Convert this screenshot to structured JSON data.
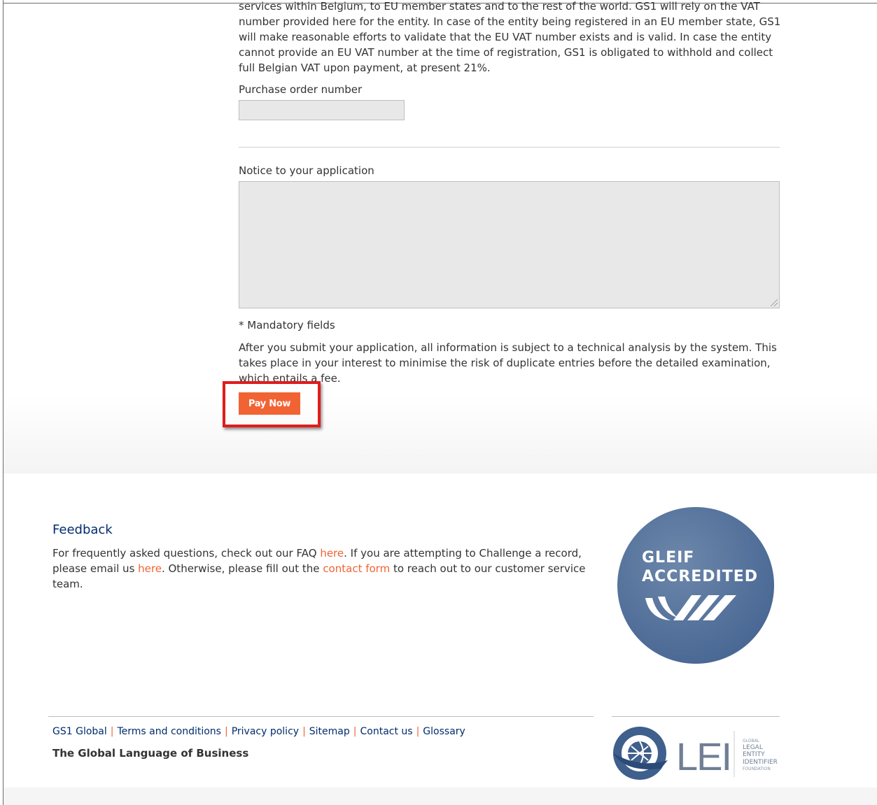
{
  "form": {
    "vat_text": "services within Belgium, to EU member states and to the rest of the world. GS1 will rely on the VAT number provided here for the entity. In case of the entity being registered in an EU member state, GS1 will make reasonable efforts to validate that the EU VAT number exists and is valid. In case the entity cannot provide an EU VAT number at the time of registration, GS1 is obligated to withhold and collect full Belgian VAT upon payment, at present 21%.",
    "po_label": "Purchase order number",
    "po_value": "",
    "notice_label": "Notice to your application",
    "notice_value": "",
    "mandatory_note": "* Mandatory fields",
    "submit_info": "After you submit your application, all information is subject to a technical analysis by the system. This takes place in your interest to minimise the risk of duplicate entries before the detailed examination, which entails a fee.",
    "pay_button": "Pay Now"
  },
  "feedback": {
    "title": "Feedback",
    "text_1": "For frequently asked questions, check out our FAQ ",
    "link_faq": "here",
    "text_2": ". If you are attempting to Challenge a record, please email us ",
    "link_email": "here",
    "text_3": ". Otherwise, please fill out the ",
    "link_contact": "contact form",
    "text_4": " to reach out to our customer service team."
  },
  "badge": {
    "line1": "GLEIF",
    "line2": "ACCREDITED"
  },
  "footer": {
    "links": [
      "GS1 Global",
      "Terms and conditions",
      "Privacy policy",
      "Sitemap",
      "Contact us",
      "Glossary"
    ],
    "tagline": "The Global Language of Business",
    "lei_text": "LEI",
    "lei_sub": [
      "GLOBAL",
      "LEGAL",
      "ENTITY",
      "IDENTIFIER",
      "FOUNDATION"
    ]
  },
  "colors": {
    "accent": "#f26334",
    "navy": "#002c6c",
    "highlight": "#e01c1c",
    "badge": "#52709a"
  }
}
